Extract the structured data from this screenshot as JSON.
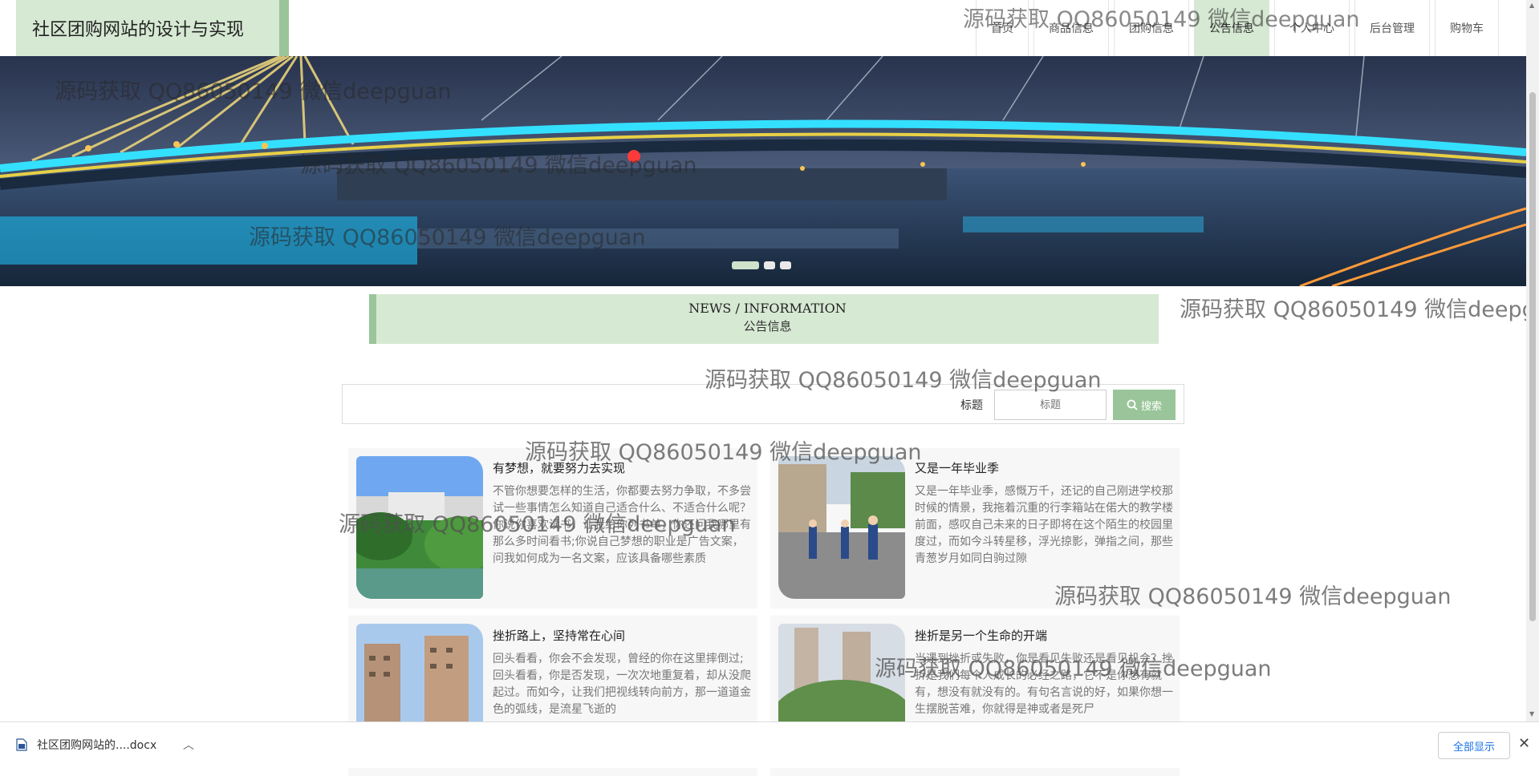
{
  "header": {
    "brand": "社区团购网站的设计与实现",
    "nav": [
      {
        "label": "首页"
      },
      {
        "label": "商品信息"
      },
      {
        "label": "团购信息"
      },
      {
        "label": "公告信息"
      },
      {
        "label": "个人中心"
      },
      {
        "label": "后台管理"
      },
      {
        "label": "购物车"
      }
    ],
    "active_index": 3
  },
  "section": {
    "title_en": "NEWS / INFORMATION",
    "title_cn": "公告信息"
  },
  "search": {
    "label": "标题",
    "placeholder": "标题",
    "button_label": "搜索"
  },
  "news": [
    {
      "title": "有梦想，就要努力去实现",
      "desc": "不管你想要怎样的生活，你都要去努力争取，不多尝试一些事情怎么知道自己适合什么、不适合什么呢？你说你喜欢读书，让我给你列书单，你还问我哪里有那么多时间看书;你说自己梦想的职业是广告文案，问我如何成为一名文案，应该具备哪些素质",
      "image": "green-campus"
    },
    {
      "title": "又是一年毕业季",
      "desc": "又是一年毕业季，感慨万千，还记的自己刚进学校那时候的情景，我拖着沉重的行李箱站在偌大的教学楼前面，感叹自己未来的日子即将在这个陌生的校园里度过，而如今斗转星移，浮光掠影，弹指之间，那些青葱岁月如同白驹过隙",
      "image": "graduation-walk"
    },
    {
      "title": "挫折路上，坚持常在心间",
      "desc": "回头看看，你会不会发现，曾经的你在这里摔倒过;回头看看，你是否发现，一次次地重复着，却从没爬起过。而如今，让我们把视线转向前方，那一道道金色的弧线，是流星飞逝的",
      "image": "apartment-towers"
    },
    {
      "title": "挫折是另一个生命的开端",
      "desc": "当遇到挫折或失败，你是看见失败还是看见机会？挫折是我们每个人成长的必经之路，它不是你想有就有，想没有就没有的。有句名言说的好，如果你想一生摆脱苦难，你就得是神或者是死尸",
      "image": "garden-rockery"
    }
  ],
  "watermark": "源码获取 QQ86050149 微信deepguan",
  "download": {
    "filename": "社区团购网站的....docx",
    "show_all": "全部显示"
  },
  "colors": {
    "accent_light": "#d6e9d3",
    "accent": "#9ac59a"
  }
}
